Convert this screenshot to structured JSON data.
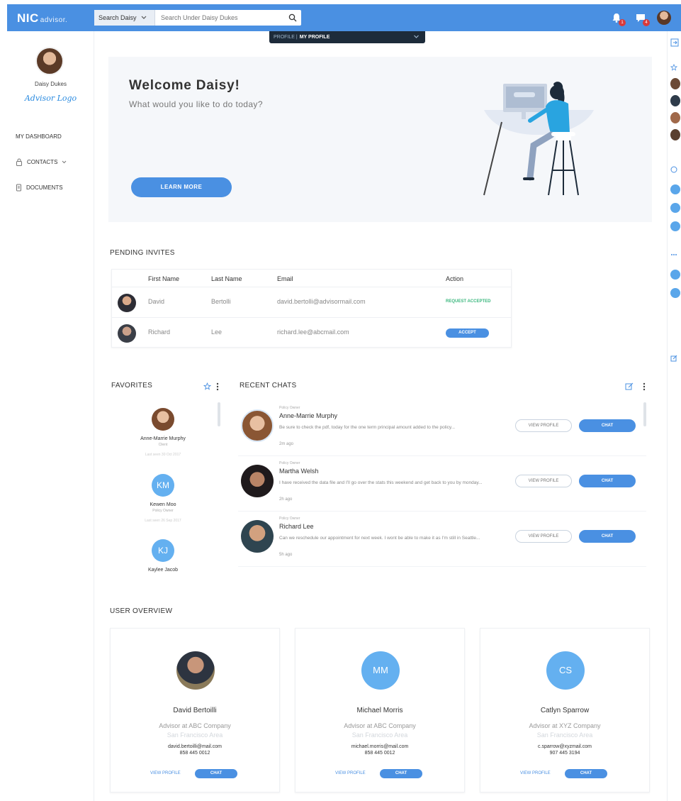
{
  "brand": {
    "logo": "NIC",
    "logo_sub": "advisor."
  },
  "search": {
    "scope": "Search Daisy",
    "placeholder": "Search Under Daisy Dukes"
  },
  "header": {
    "notifications_badge": "1",
    "messages_badge": "4"
  },
  "profile_bar": {
    "prefix": "PROFILE |",
    "current": "MY PROFILE"
  },
  "sidebar": {
    "user_name": "Daisy Dukes",
    "signature": "Advisor Logo",
    "items": [
      {
        "label": "MY DASHBOARD",
        "icon": "none"
      },
      {
        "label": "CONTACTS",
        "icon": "lock-icon"
      },
      {
        "label": "DOCUMENTS",
        "icon": "document-icon"
      }
    ]
  },
  "welcome": {
    "title": "Welcome Daisy!",
    "subtitle": "What would you like to do today?",
    "button": "LEARN MORE"
  },
  "pending_invites": {
    "title": "PENDING INVITES",
    "columns": [
      "First Name",
      "Last Name",
      "Email",
      "Action"
    ],
    "rows": [
      {
        "first": "David",
        "last": "Bertolli",
        "email": "david.bertolli@advisormail.com",
        "action": "REQUEST ACCEPTED"
      },
      {
        "first": "Richard",
        "last": "Lee",
        "email": "richard.lee@abcmail.com",
        "action": "ACCEPT"
      }
    ]
  },
  "favorites": {
    "title": "FAVORITES",
    "items": [
      {
        "name": "Anne-Marrie Murphy",
        "role": "Client",
        "seen": "Last seen 30 Oct 2017",
        "initials": ""
      },
      {
        "name": "Kewen Moo",
        "role": "Policy Owner",
        "seen": "Last seen 26 Sep 2017",
        "initials": "KM"
      },
      {
        "name": "Kaylee Jacob",
        "role": "",
        "seen": "",
        "initials": "KJ"
      }
    ]
  },
  "recent_chats": {
    "title": "RECENT CHATS",
    "view_profile": "VIEW PROFILE",
    "chat": "CHAT",
    "items": [
      {
        "label": "Policy Owner",
        "name": "Anne-Marrie Murphy",
        "msg": "Be sure to check the pdf, today for the one term principal amount added to the policy...",
        "time": "2m ago"
      },
      {
        "label": "Policy Owner",
        "name": "Martha Welsh",
        "msg": "I have received the data file and I'll go over the stats this weekend and get back to you by monday...",
        "time": "2h ago"
      },
      {
        "label": "Policy Owner",
        "name": "Richard Lee",
        "msg": "Can we reschedule our appointment for next week. I wont be able to make it as I'm still in Seattle...",
        "time": "5h ago"
      }
    ]
  },
  "user_overview": {
    "title": "USER OVERVIEW",
    "view_profile": "VIEW PROFILE",
    "chat": "CHAT",
    "cards": [
      {
        "name": "David Bertoilli",
        "role": "Advisor at ABC Company",
        "location": "San Francisco Area",
        "email": "david.bertoilli@mail.com",
        "phone": "858 445 0012",
        "initials": ""
      },
      {
        "name": "Michael Morris",
        "role": "Advisor at ABC Company",
        "location": "San Francisco Area",
        "email": "michael.morris@mail.com",
        "phone": "858 445 0012",
        "initials": "MM"
      },
      {
        "name": "Catlyn Sparrow",
        "role": "Advisor at XYZ Company",
        "location": "San Francisco Area",
        "email": "c.sparrow@xyzmail.com",
        "phone": "907 445 3194",
        "initials": "CS"
      }
    ]
  },
  "colors": {
    "primary": "#4a90e2",
    "avatar_blue": "#64b0f0",
    "nav_dark": "#1d2b3a",
    "success": "#3bb77e",
    "badge_red": "#d93a3a"
  }
}
